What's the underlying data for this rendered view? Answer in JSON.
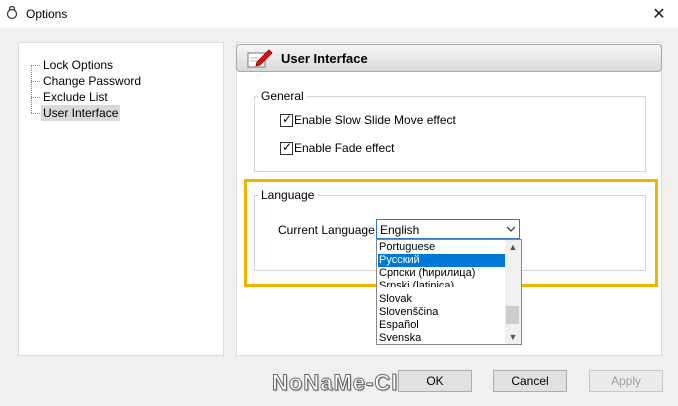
{
  "window": {
    "title": "Options",
    "close_label": "✕"
  },
  "tree": {
    "items": [
      {
        "label": "Lock Options",
        "selected": false
      },
      {
        "label": "Change Password",
        "selected": false
      },
      {
        "label": "Exclude List",
        "selected": false
      },
      {
        "label": "User Interface",
        "selected": true
      }
    ]
  },
  "panel": {
    "header": "User Interface",
    "icon": "pencil-note-icon",
    "general": {
      "legend": "General",
      "options": [
        {
          "label": "Enable Slow Slide Move effect",
          "checked": true
        },
        {
          "label": "Enable Fade effect",
          "checked": true
        }
      ]
    },
    "language": {
      "legend": "Language",
      "current_label": "Current Language",
      "selected_value": "English",
      "options": [
        {
          "label": "Portuguese",
          "highlighted": false
        },
        {
          "label": "Русский",
          "highlighted": true
        },
        {
          "label": "Српски (ћирилица)",
          "highlighted": false
        },
        {
          "label": "Srpski (latinica)",
          "highlighted": false
        },
        {
          "label": "Slovak",
          "highlighted": false
        },
        {
          "label": "Slovenščina",
          "highlighted": false
        },
        {
          "label": "Español",
          "highlighted": false
        },
        {
          "label": "Svenska",
          "highlighted": false
        }
      ]
    }
  },
  "buttons": {
    "ok": "OK",
    "cancel": "Cancel",
    "apply": "Apply"
  },
  "watermark": "NoNaMe-Club",
  "colors": {
    "highlight_border": "#f0b400",
    "selection": "#0078d7"
  }
}
